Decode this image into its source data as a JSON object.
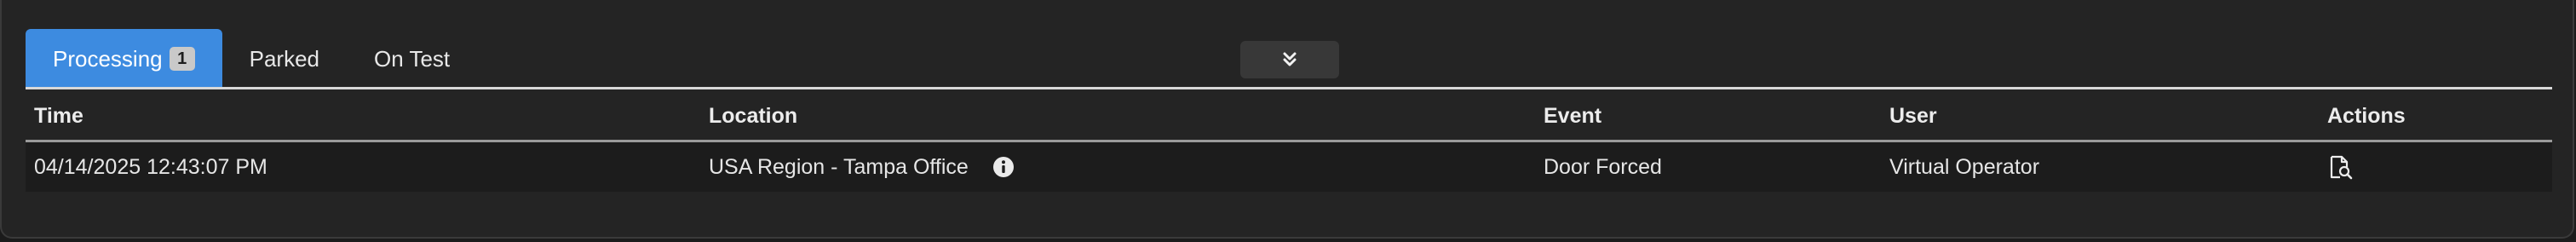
{
  "tabs": [
    {
      "label": "Processing",
      "badge": "1",
      "active": true
    },
    {
      "label": "Parked",
      "active": false
    },
    {
      "label": "On Test",
      "active": false
    }
  ],
  "collapse_button": {
    "icon": "double-chevron-down-icon"
  },
  "table": {
    "columns": [
      "Time",
      "Location",
      "Event",
      "User",
      "Actions"
    ],
    "rows": [
      {
        "time": "04/14/2025 12:43:07 PM",
        "location": "USA Region - Tampa Office",
        "location_icon": "info-icon",
        "event": "Door Forced",
        "user": "Virtual Operator",
        "action_icon": "view-document-icon"
      }
    ]
  },
  "colors": {
    "accent": "#3d8be0",
    "panel_background": "#242424",
    "row_background": "#1c1c1c"
  }
}
